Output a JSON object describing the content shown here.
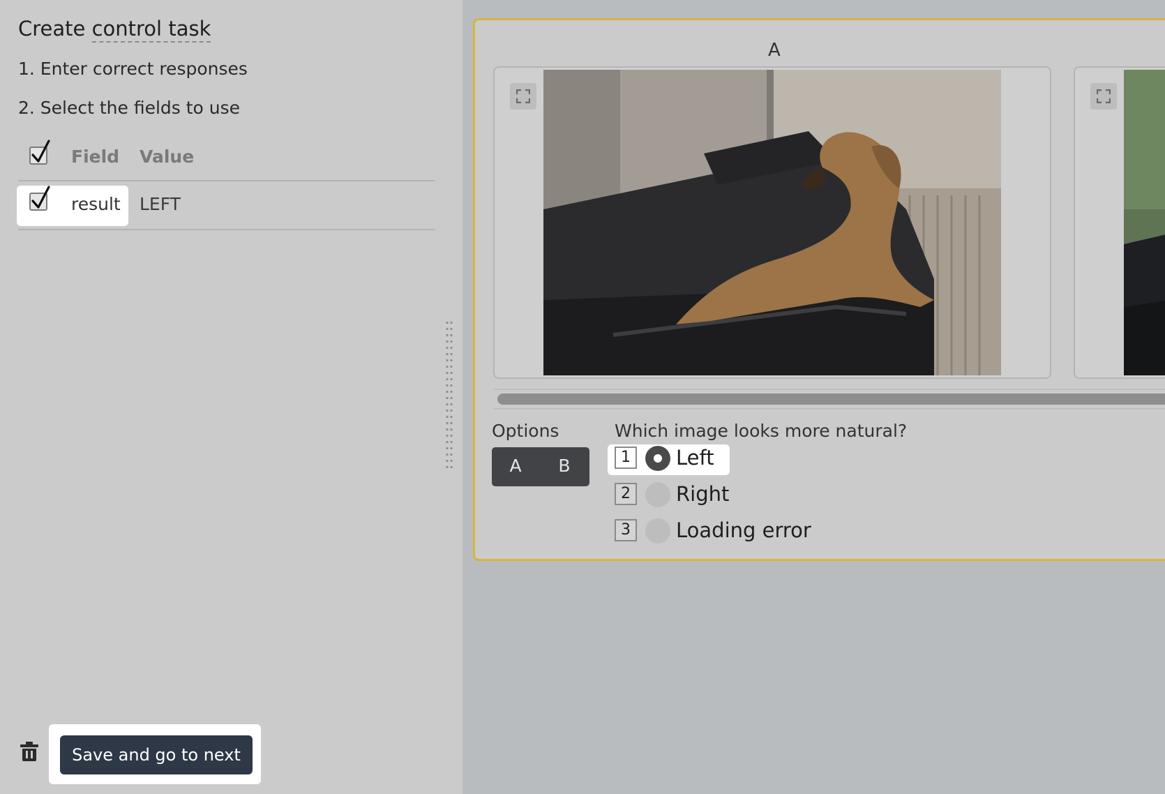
{
  "sidebar": {
    "title_prefix": "Create ",
    "title_link": "control task",
    "step1": "1. Enter correct responses",
    "step2": "2. Select the fields to use",
    "table": {
      "headers": {
        "field": "Field",
        "value": "Value"
      },
      "rows": [
        {
          "field": "result",
          "value": "LEFT",
          "checked": true
        }
      ]
    },
    "save_button": "Save and go to next",
    "delete_icon": "trash-icon"
  },
  "task": {
    "image_label": "A",
    "options_label": "Options",
    "toggle": {
      "a": "A",
      "b": "B"
    },
    "question": "Which image looks more natural?",
    "answers": [
      {
        "key": "1",
        "label": "Left",
        "selected": true
      },
      {
        "key": "2",
        "label": "Right",
        "selected": false
      },
      {
        "key": "3",
        "label": "Loading error",
        "selected": false
      }
    ]
  },
  "colors": {
    "accent_border": "#d8b53c",
    "button_dark": "#2e3846",
    "panel_bg": "#cbcbcb",
    "page_bg": "#b9bcbf"
  }
}
